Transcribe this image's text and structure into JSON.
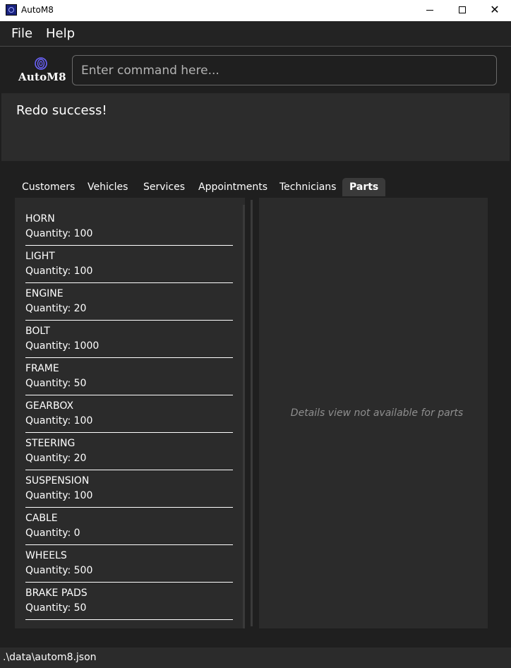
{
  "window": {
    "title": "AutoM8",
    "minimize_icon": "minimize-icon",
    "maximize_icon": "maximize-icon",
    "close_symbol": "✕"
  },
  "menu": {
    "file": "File",
    "help": "Help"
  },
  "logo": {
    "text": "AutoM8",
    "icon": "wheel-icon",
    "accent": "#6c63ff"
  },
  "command": {
    "value": "",
    "placeholder": "Enter command here..."
  },
  "result": {
    "message": "Redo success!"
  },
  "tabs": [
    {
      "label": "Customers",
      "active": false
    },
    {
      "label": "Vehicles",
      "active": false
    },
    {
      "label": "Services",
      "active": false
    },
    {
      "label": "Appointments",
      "active": false
    },
    {
      "label": "Technicians",
      "active": false
    },
    {
      "label": "Parts",
      "active": true
    }
  ],
  "parts": [
    {
      "name": "HORN",
      "quantity": "Quantity: 100"
    },
    {
      "name": "LIGHT",
      "quantity": "Quantity: 100"
    },
    {
      "name": "ENGINE",
      "quantity": "Quantity: 20"
    },
    {
      "name": "BOLT",
      "quantity": "Quantity: 1000"
    },
    {
      "name": "FRAME",
      "quantity": "Quantity: 50"
    },
    {
      "name": "GEARBOX",
      "quantity": "Quantity: 100"
    },
    {
      "name": "STEERING",
      "quantity": "Quantity: 20"
    },
    {
      "name": "SUSPENSION",
      "quantity": "Quantity: 100"
    },
    {
      "name": "CABLE",
      "quantity": "Quantity: 0"
    },
    {
      "name": "WHEELS",
      "quantity": "Quantity: 500"
    },
    {
      "name": "BRAKE PADS",
      "quantity": "Quantity: 50"
    }
  ],
  "details": {
    "message": "Details view not available for parts"
  },
  "status": {
    "path": ".\\data\\autom8.json"
  }
}
